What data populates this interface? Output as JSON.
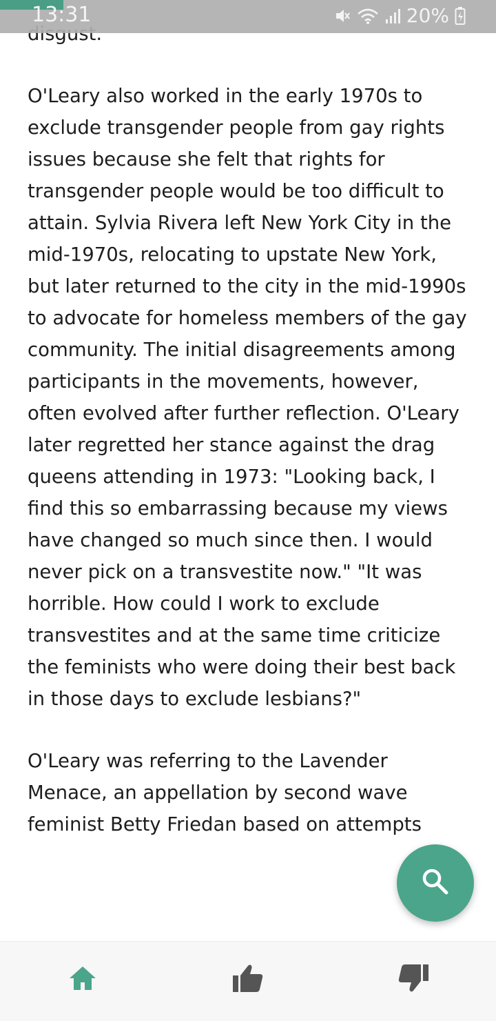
{
  "status_bar": {
    "time": "13:31",
    "battery_percent": "20%",
    "icons": [
      "mute-icon",
      "wifi-icon",
      "signal-icon",
      "battery-charging-icon"
    ],
    "accent_color": "#4a9e86"
  },
  "article": {
    "paragraphs": [
      "disgust.",
      "O'Leary also worked in the early 1970s to exclude transgender people from gay rights issues because she felt that rights for transgender people would be too difficult to attain. Sylvia Rivera left New York City in the mid-1970s, relocating to upstate New York, but later returned to the city in the mid-1990s to advocate for homeless members of the gay community. The initial disagreements among participants in the movements, however, often evolved after further reflection. O'Leary later regretted her stance against the drag queens attending in 1973: \"Looking back, I find this so embarrassing because my views have changed so much since then. I would never pick on a transvestite now.\" \"It was horrible. How could I work to exclude transvestites and at the same time criticize the feminists who were doing their best back in those days to exclude lesbians?\"",
      "O'Leary was referring to the Lavender Menace, an appellation by second wave feminist Betty Friedan based on attempts"
    ]
  },
  "fab": {
    "icon": "search-icon",
    "color": "#4ba58a"
  },
  "bottom_nav": {
    "items": [
      {
        "icon": "home-icon",
        "active": true,
        "color": "#4ba58a"
      },
      {
        "icon": "thumbs-up-icon",
        "active": false,
        "color": "#555555"
      },
      {
        "icon": "thumbs-down-icon",
        "active": false,
        "color": "#555555"
      }
    ]
  }
}
